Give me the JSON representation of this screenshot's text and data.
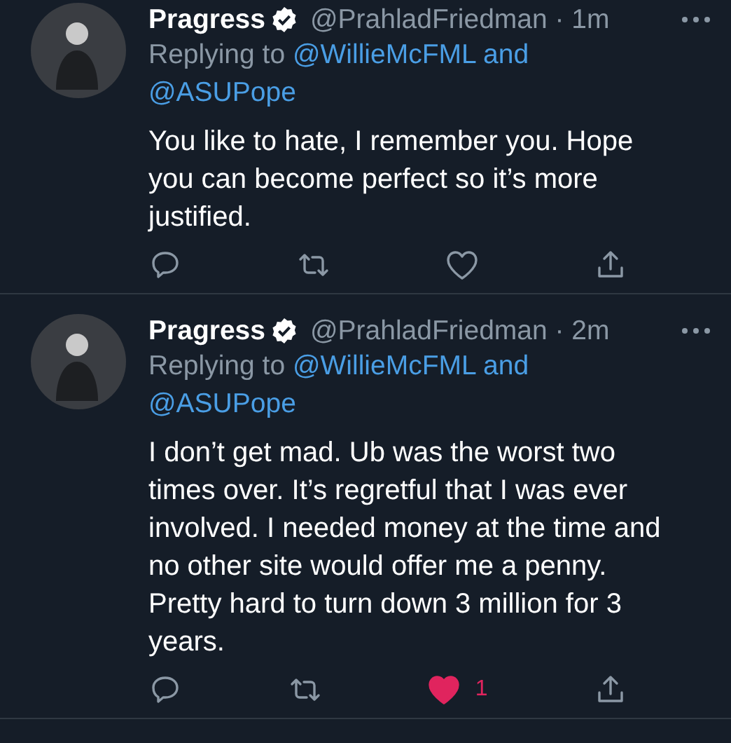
{
  "tweets": [
    {
      "name": "Pragress",
      "verified": true,
      "handle_time": "@PrahladFriedman · 1m",
      "replying_label": "Replying to",
      "reply_links": [
        "@WillieMcFML and",
        "@ASUPope"
      ],
      "text": "You like to hate, I remember you. Hope you can become perfect so it’s more justified.",
      "liked": false
    },
    {
      "name": "Pragress",
      "verified": true,
      "handle_time": "@PrahladFriedman · 2m",
      "replying_label": "Replying to",
      "reply_links": [
        "@WillieMcFML and",
        "@ASUPope"
      ],
      "text": "I don’t get mad. Ub was the worst two times over. It’s regretful that I was ever involved. I needed money at the time and no other site would offer me a penny. Pretty hard to turn down 3 million for 3 years.",
      "liked": true,
      "like_count": "1"
    }
  ]
}
